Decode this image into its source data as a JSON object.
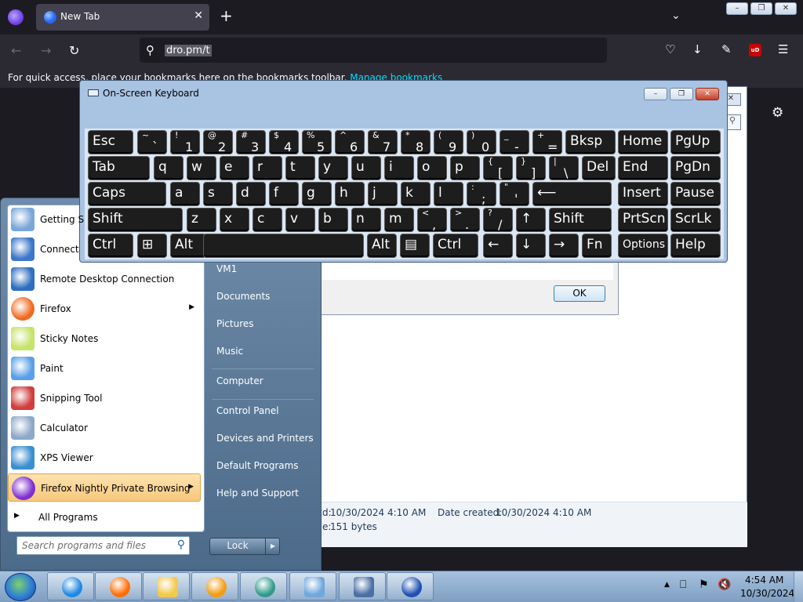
{
  "browser": {
    "tab_title": "New Tab",
    "tab_close": "✕",
    "new_tab_glyph": "+",
    "url_text": "dro.pm/t",
    "bookmarks_text": "For quick access, place your bookmarks here on the bookmarks toolbar.",
    "bookmarks_link": "Manage bookmarks",
    "ublock_label": "uD"
  },
  "dialog": {
    "ok_label": "OK"
  },
  "details": {
    "modified_label": "d:",
    "modified_value": "10/30/2024 4:10 AM",
    "created_label": "Date created:",
    "created_value": "10/30/2024 4:10 AM",
    "size_label": "e:",
    "size_value": "151 bytes"
  },
  "start_menu": {
    "programs": [
      {
        "label": "Getting S",
        "icon": "getting-started-icon"
      },
      {
        "label": "Connect",
        "icon": "projector-icon"
      },
      {
        "label": "Remote Desktop Connection",
        "icon": "remote-desktop-icon"
      },
      {
        "label": "Firefox",
        "icon": "firefox-icon",
        "arrow": "▶"
      },
      {
        "label": "Sticky Notes",
        "icon": "sticky-notes-icon"
      },
      {
        "label": "Paint",
        "icon": "paint-icon"
      },
      {
        "label": "Snipping Tool",
        "icon": "snipping-tool-icon"
      },
      {
        "label": "Calculator",
        "icon": "calculator-icon"
      },
      {
        "label": "XPS Viewer",
        "icon": "xps-viewer-icon"
      },
      {
        "label": "Firefox Nightly Private Browsing",
        "icon": "firefox-private-icon",
        "arrow": "▶"
      }
    ],
    "all_programs": "All Programs",
    "search_placeholder": "Search programs and files",
    "right_links": [
      "VM1",
      "Documents",
      "Pictures",
      "Music",
      "Computer",
      "Control Panel",
      "Devices and Printers",
      "Default Programs",
      "Help and Support"
    ],
    "lock_label": "Lock",
    "lock_arrow": "▶"
  },
  "osk": {
    "title": "On-Screen Keyboard",
    "rows": [
      [
        {
          "m": "Esc"
        },
        {
          "s": "~",
          "b": "`"
        },
        {
          "s": "!",
          "b": "1"
        },
        {
          "s": "@",
          "b": "2"
        },
        {
          "s": "#",
          "b": "3"
        },
        {
          "s": "$",
          "b": "4"
        },
        {
          "s": "%",
          "b": "5"
        },
        {
          "s": "^",
          "b": "6"
        },
        {
          "s": "&",
          "b": "7"
        },
        {
          "s": "*",
          "b": "8"
        },
        {
          "s": "(",
          "b": "9"
        },
        {
          "s": ")",
          "b": "0"
        },
        {
          "s": "_",
          "b": "-"
        },
        {
          "s": "+",
          "b": "="
        },
        {
          "m": "Bksp"
        },
        {
          "m": "Home"
        },
        {
          "m": "PgUp"
        }
      ],
      [
        {
          "m": "Tab"
        },
        {
          "m": "q"
        },
        {
          "m": "w"
        },
        {
          "m": "e"
        },
        {
          "m": "r"
        },
        {
          "m": "t"
        },
        {
          "m": "y"
        },
        {
          "m": "u"
        },
        {
          "m": "i"
        },
        {
          "m": "o"
        },
        {
          "m": "p"
        },
        {
          "s": "{",
          "b": "["
        },
        {
          "s": "}",
          "b": "]"
        },
        {
          "s": "|",
          "b": "\\"
        },
        {
          "m": "Del"
        },
        {
          "m": "End"
        },
        {
          "m": "PgDn"
        }
      ],
      [
        {
          "m": "Caps"
        },
        {
          "m": "a"
        },
        {
          "m": "s"
        },
        {
          "m": "d"
        },
        {
          "m": "f"
        },
        {
          "m": "g"
        },
        {
          "m": "h"
        },
        {
          "m": "j"
        },
        {
          "m": "k"
        },
        {
          "m": "l"
        },
        {
          "s": ":",
          "b": ";"
        },
        {
          "s": "\"",
          "b": "'"
        },
        {
          "m": "⟵"
        },
        {
          "m": "Insert"
        },
        {
          "m": "Pause"
        }
      ],
      [
        {
          "m": "Shift"
        },
        {
          "m": "z"
        },
        {
          "m": "x"
        },
        {
          "m": "c"
        },
        {
          "m": "v"
        },
        {
          "m": "b"
        },
        {
          "m": "n"
        },
        {
          "m": "m"
        },
        {
          "s": "<",
          "b": ","
        },
        {
          "s": ">",
          "b": "."
        },
        {
          "s": "?",
          "b": "/"
        },
        {
          "m": "↑"
        },
        {
          "m": "Shift"
        },
        {
          "m": "PrtScn"
        },
        {
          "m": "ScrLk"
        }
      ],
      [
        {
          "m": "Ctrl"
        },
        {
          "m": "⊞"
        },
        {
          "m": "Alt"
        },
        {
          "m": ""
        },
        {
          "m": "Alt"
        },
        {
          "m": "▤"
        },
        {
          "m": "Ctrl"
        },
        {
          "m": "←"
        },
        {
          "m": "↓"
        },
        {
          "m": "→"
        },
        {
          "m": "Fn"
        },
        {
          "m": "Options"
        },
        {
          "m": "Help"
        }
      ]
    ]
  },
  "tray": {
    "time": "4:54 AM",
    "date": "10/30/2024",
    "icons": [
      "show-hidden-icon",
      "network-icon",
      "action-center-flag-icon",
      "volume-muted-icon"
    ]
  },
  "taskbar": {
    "pinned": [
      "internet-explorer-icon",
      "firefox-icon",
      "explorer-folder-icon",
      "media-player-icon",
      "remote-assistance-icon",
      "paint-icon",
      "network-printer-icon",
      "info-icon"
    ]
  },
  "colors": {
    "highlight": "#f7c77c",
    "accent_link": "#00ddff"
  }
}
